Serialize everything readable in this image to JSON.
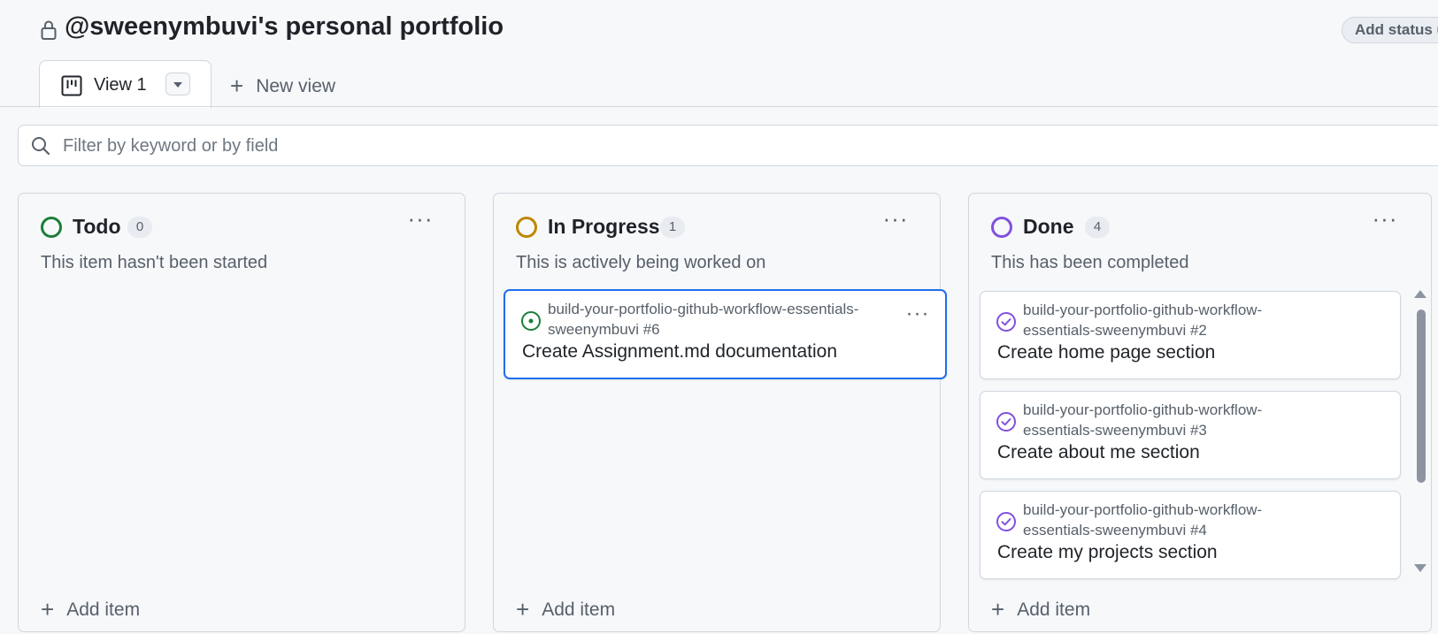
{
  "project": {
    "title": "@sweenymbuvi's personal portfolio",
    "status_button_label": "Add status u"
  },
  "tabs": {
    "active_view_label": "View 1",
    "new_view_label": "New view"
  },
  "filter": {
    "placeholder": "Filter by keyword or by field",
    "value": ""
  },
  "columns": [
    {
      "name": "Todo",
      "count": "0",
      "description": "This item hasn't been started",
      "color": "#1a7f37",
      "add_item_label": "Add item",
      "cards": []
    },
    {
      "name": "In Progress",
      "count": "1",
      "description": "This is actively being worked on",
      "color": "#bf8700",
      "add_item_label": "Add item",
      "cards": [
        {
          "repo_line1": "build-your-portfolio-github-workflow-essentials-",
          "repo_line2": "sweenymbuvi #6",
          "title": "Create Assignment.md documentation",
          "status": "open",
          "selected": true,
          "icon": "issue-opened-icon"
        }
      ]
    },
    {
      "name": "Done",
      "count": "4",
      "description": "This has been completed",
      "color": "#8250df",
      "add_item_label": "Add item",
      "cards": [
        {
          "repo_line1": "build-your-portfolio-github-workflow-",
          "repo_line2": "essentials-sweenymbuvi #2",
          "title": "Create home page section",
          "status": "closed",
          "icon": "issue-closed-icon"
        },
        {
          "repo_line1": "build-your-portfolio-github-workflow-",
          "repo_line2": "essentials-sweenymbuvi #3",
          "title": "Create about me section",
          "status": "closed",
          "icon": "issue-closed-icon"
        },
        {
          "repo_line1": "build-your-portfolio-github-workflow-",
          "repo_line2": "essentials-sweenymbuvi #4",
          "title": "Create my projects section",
          "status": "closed",
          "icon": "issue-closed-icon"
        }
      ]
    }
  ],
  "colors": {
    "accent": "#1f6feb",
    "open": "#1a7f37",
    "done": "#8250df",
    "in_progress": "#bf8700"
  }
}
